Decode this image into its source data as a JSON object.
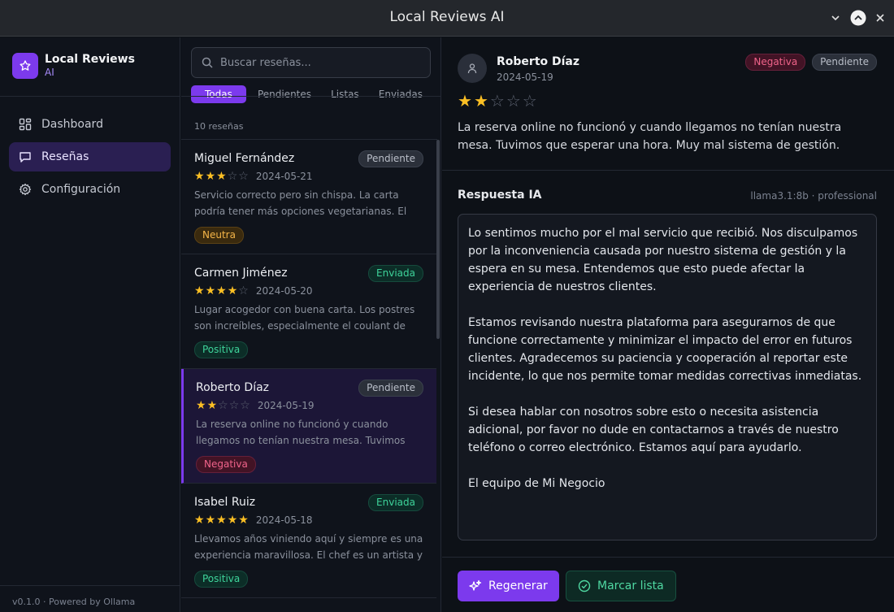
{
  "window": {
    "title": "Local Reviews AI"
  },
  "sidebar": {
    "brand_name": "Local Reviews",
    "brand_sub": "AI",
    "items": [
      {
        "label": "Dashboard",
        "icon": "dashboard-icon"
      },
      {
        "label": "Reseñas",
        "icon": "chat-icon"
      },
      {
        "label": "Configuración",
        "icon": "gear-icon"
      }
    ],
    "footer": "v0.1.0 · Powered by Ollama"
  },
  "list": {
    "search_placeholder": "Buscar reseñas...",
    "tabs": [
      "Todas",
      "Pendientes",
      "Listas",
      "Enviadas"
    ],
    "count": "10 reseñas",
    "reviews": [
      {
        "name": "Miguel Fernández",
        "status": "Pendiente",
        "rating": 3,
        "date": "2024-05-21",
        "text": "Servicio correcto pero sin chispa. La carta podría tener más opciones vegetarianas. El ambiente…",
        "sentiment": "Neutra"
      },
      {
        "name": "Carmen Jiménez",
        "status": "Enviada",
        "rating": 4,
        "date": "2024-05-20",
        "text": "Lugar acogedor con buena carta. Los postres son increíbles, especialmente el coulant de chocolat…",
        "sentiment": "Positiva"
      },
      {
        "name": "Roberto Díaz",
        "status": "Pendiente",
        "rating": 2,
        "date": "2024-05-19",
        "text": "La reserva online no funcionó y cuando llegamos no tenían nuestra mesa. Tuvimos que esperar…",
        "sentiment": "Negativa"
      },
      {
        "name": "Isabel Ruiz",
        "status": "Enviada",
        "rating": 5,
        "date": "2024-05-18",
        "text": "Llevamos años viniendo aquí y siempre es una experiencia maravillosa. El chef es un artista y el…",
        "sentiment": "Positiva"
      }
    ]
  },
  "detail": {
    "name": "Roberto Díaz",
    "date": "2024-05-19",
    "sentiment": "Negativa",
    "status": "Pendiente",
    "rating": 2,
    "text": "La reserva online no funcionó y cuando llegamos no tenían nuestra mesa. Tuvimos que esperar una hora. Muy mal sistema de gestión.",
    "ai_label": "Respuesta IA",
    "ai_model": "llama3.1:8b · professional",
    "ai_response": "Lo sentimos mucho por el mal servicio que recibió. Nos disculpamos por la inconveniencia causada por nuestro sistema de gestión y la espera en su mesa. Entendemos que esto puede afectar la experiencia de nuestros clientes.\n\nEstamos revisando nuestra plataforma para asegurarnos de que funcione correctamente y minimizar el impacto del error en futuros clientes. Agradecemos su paciencia y cooperación al reportar este incidente, lo que nos permite tomar medidas correctivas inmediatas.\n\nSi desea hablar con nosotros sobre esto o necesita asistencia adicional, por favor no dude en contactarnos a través de nuestro teléfono o correo electrónico. Estamos aquí para ayudarlo.\n\nEl equipo de Mi Negocio",
    "regen_label": "Regenerar",
    "mark_label": "Marcar lista"
  },
  "colors": {
    "accent": "#7c3aed",
    "star": "#fbbf24",
    "positive": "#3ed39a",
    "negative": "#f0638a",
    "neutral": "#f5b548"
  }
}
